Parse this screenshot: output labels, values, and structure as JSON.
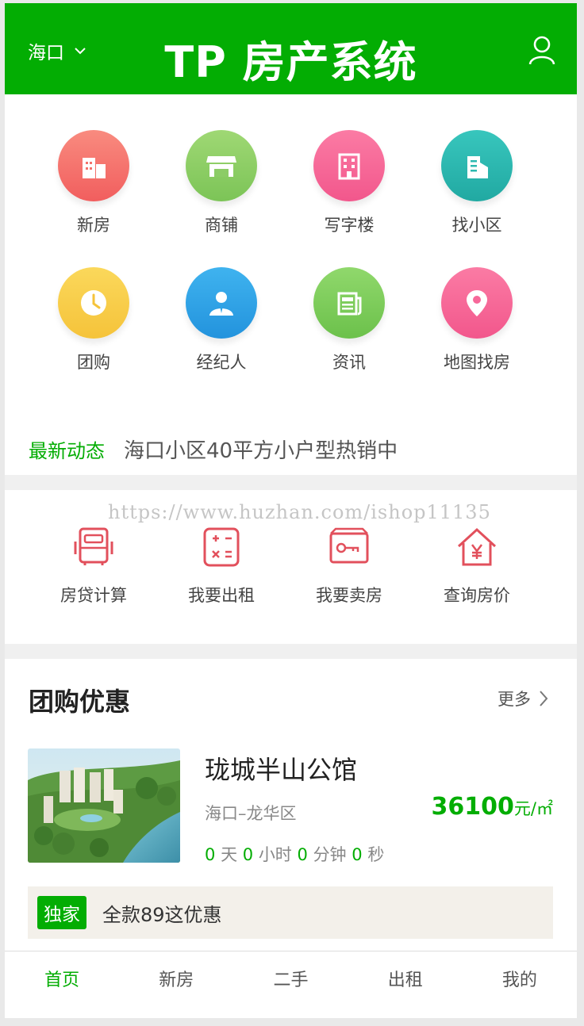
{
  "header": {
    "city": "海口",
    "title": "TP 房产系统",
    "brand_color": "#03ad03"
  },
  "categories": [
    {
      "label": "新房",
      "icon": "building-icon",
      "color": "#f4726b"
    },
    {
      "label": "商铺",
      "icon": "shop-icon",
      "color": "#8ccc66"
    },
    {
      "label": "写字楼",
      "icon": "office-icon",
      "color": "#f7689a"
    },
    {
      "label": "找小区",
      "icon": "community-icon",
      "color": "#2cb9b0"
    },
    {
      "label": "团购",
      "icon": "clock-icon",
      "color": "#f7cd46"
    },
    {
      "label": "经纪人",
      "icon": "agent-icon",
      "color": "#2ea3e6"
    },
    {
      "label": "资讯",
      "icon": "news-icon",
      "color": "#7fcc5e"
    },
    {
      "label": "地图找房",
      "icon": "map-pin-icon",
      "color": "#f7689a"
    }
  ],
  "news": {
    "tag": "最新动态",
    "text": "海口小区40平方小户型热销中"
  },
  "watermark": "https://www.huzhan.com/ishop11135",
  "tools": [
    {
      "label": "房贷计算",
      "icon": "loan-icon"
    },
    {
      "label": "我要出租",
      "icon": "calculator-icon"
    },
    {
      "label": "我要卖房",
      "icon": "key-icon"
    },
    {
      "label": "查询房价",
      "icon": "house-price-icon"
    }
  ],
  "group_buy": {
    "title": "团购优惠",
    "more": "更多",
    "item": {
      "name": "珑城半山公馆",
      "area": "海口–龙华区",
      "price": "36100",
      "price_unit": "元/㎡",
      "countdown": {
        "days": "0",
        "days_label": "天",
        "hours": "0",
        "hours_label": "小时",
        "minutes": "0",
        "minutes_label": "分钟",
        "seconds": "0",
        "seconds_label": "秒"
      }
    },
    "promo": {
      "badge": "独家",
      "text": "全款89这优惠"
    }
  },
  "bottom_nav": [
    {
      "label": "首页",
      "active": true
    },
    {
      "label": "新房",
      "active": false
    },
    {
      "label": "二手",
      "active": false
    },
    {
      "label": "出租",
      "active": false
    },
    {
      "label": "我的",
      "active": false
    }
  ]
}
